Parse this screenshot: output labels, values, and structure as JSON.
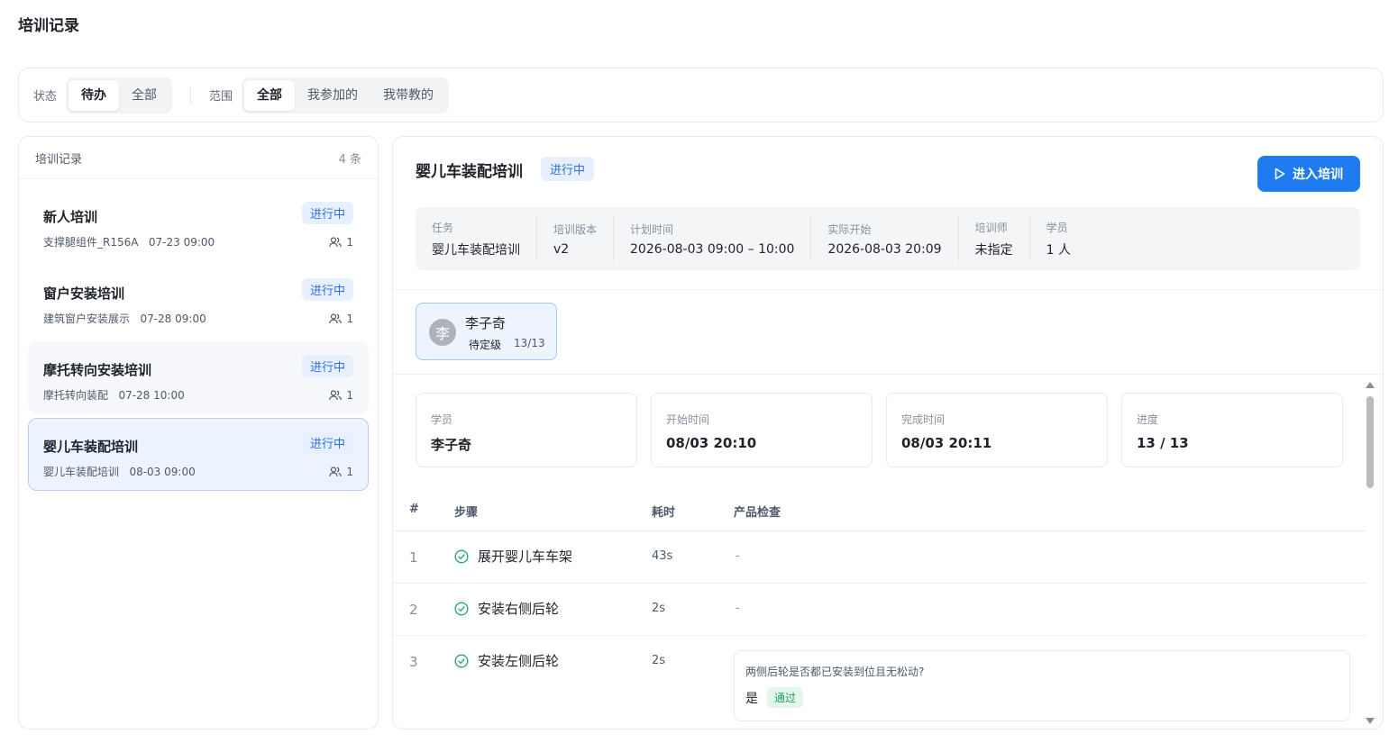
{
  "page": {
    "title": "培训记录"
  },
  "filters": {
    "status_label": "状态",
    "status_options": [
      "待办",
      "全部"
    ],
    "status_selected": "待办",
    "scope_label": "范围",
    "scope_options": [
      "全部",
      "我参加的",
      "我带教的"
    ],
    "scope_selected": "全部"
  },
  "records": {
    "header_title": "培训记录",
    "count": "4 条",
    "items": [
      {
        "title": "新人培训",
        "badge": "进行中",
        "meta": "支撑腿组件_R156A   07-23 09:00",
        "people": "1",
        "state": "normal"
      },
      {
        "title": "窗户安装培训",
        "badge": "进行中",
        "meta": "建筑窗户安装展示   07-28 09:00",
        "people": "1",
        "state": "normal"
      },
      {
        "title": "摩托转向安装培训",
        "badge": "进行中",
        "meta": "摩托转向装配   07-28 10:00",
        "people": "1",
        "state": "hover"
      },
      {
        "title": "婴儿车装配培训",
        "badge": "进行中",
        "meta": "婴儿车装配培训   08-03 09:00",
        "people": "1",
        "state": "selected"
      }
    ]
  },
  "detail": {
    "title": "婴儿车装配培训",
    "badge": "进行中",
    "enter_button": "进入培训",
    "info": [
      {
        "key": "任务",
        "value": "婴儿车装配培训"
      },
      {
        "key": "培训版本",
        "value": "v2"
      },
      {
        "key": "计划时间",
        "value": "2026-08-03 09:00 – 10:00"
      },
      {
        "key": "实际开始",
        "value": "2026-08-03 20:09"
      },
      {
        "key": "培训师",
        "value": "未指定"
      },
      {
        "key": "学员",
        "value": "1 人"
      }
    ],
    "trainee": {
      "avatar_char": "李",
      "name": "李子奇",
      "level": "待定级",
      "progress": "13/13"
    },
    "stats": [
      {
        "key": "学员",
        "value": "李子奇"
      },
      {
        "key": "开始时间",
        "value": "08/03 20:10"
      },
      {
        "key": "完成时间",
        "value": "08/03 20:11"
      },
      {
        "key": "进度",
        "value": "13 / 13"
      }
    ],
    "table": {
      "headers": {
        "idx": "#",
        "step": "步骤",
        "time": "耗时",
        "check": "产品检查"
      },
      "rows": [
        {
          "idx": "1",
          "step": "展开婴儿车车架",
          "time": "43s",
          "check": "-"
        },
        {
          "idx": "2",
          "step": "安装右侧后轮",
          "time": "2s",
          "check": "-"
        },
        {
          "idx": "3",
          "step": "安装左侧后轮",
          "time": "2s",
          "check_question": "两侧后轮是否都已安装到位且无松动?",
          "check_answer": "是",
          "check_result": "通过"
        }
      ]
    }
  },
  "colors": {
    "accent": "#1f7cf0",
    "badge_bg": "#e8f0ff",
    "badge_text": "#2f6fe4",
    "success": "#1e9e5a",
    "step_done_icon": "#2aa876"
  },
  "icons": {
    "enter_button": "play-triangle-icon",
    "people": "people-icon",
    "step_done": "check-circle-icon"
  }
}
